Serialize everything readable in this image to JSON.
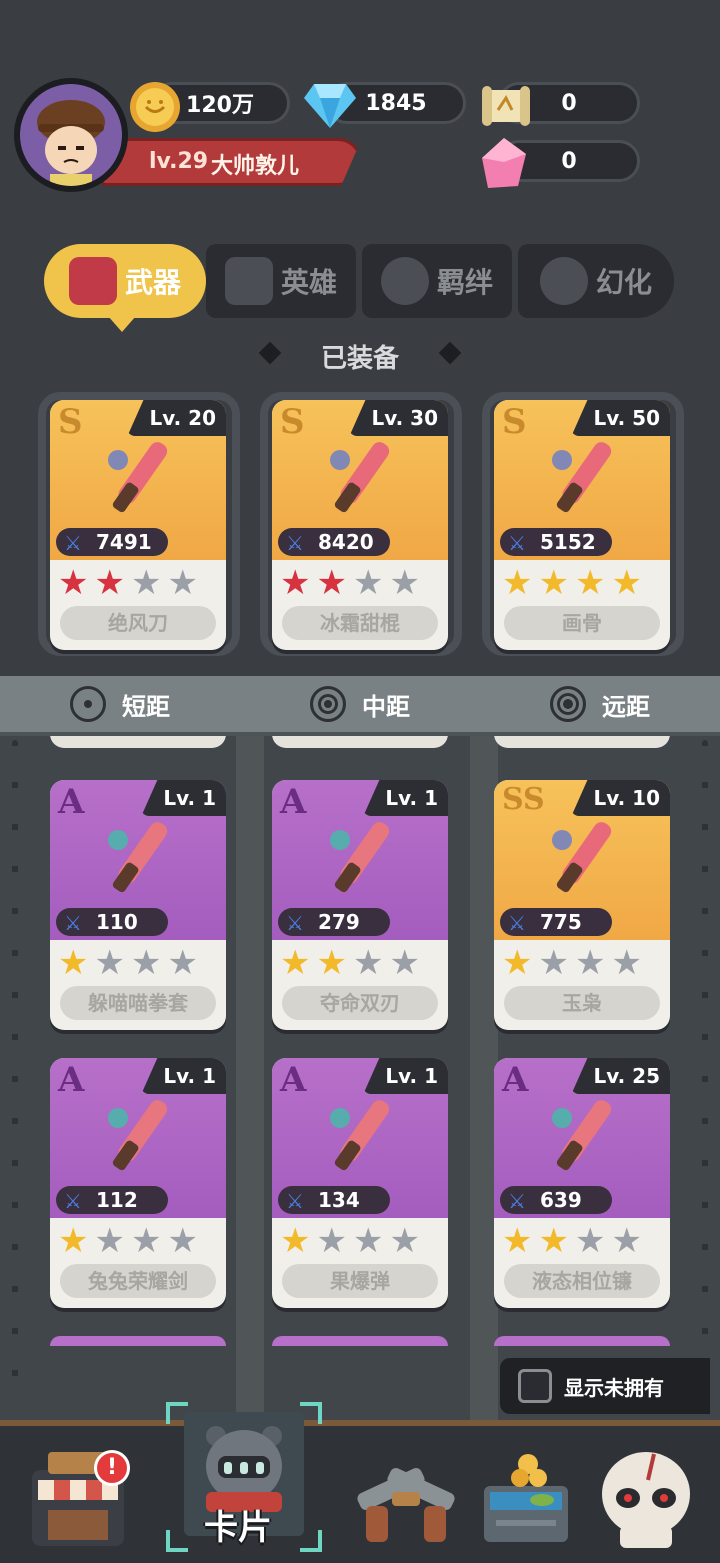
{
  "player": {
    "level": "lv.29",
    "name": "大帅敦儿"
  },
  "resources": {
    "gold": "120万",
    "diamond": "1845",
    "scroll": "0",
    "crystal": "0"
  },
  "tabs": [
    {
      "label": "武器",
      "active": true
    },
    {
      "label": "英雄",
      "active": false
    },
    {
      "label": "羁绊",
      "active": false
    },
    {
      "label": "幻化",
      "active": false
    }
  ],
  "equipped_title": "已装备",
  "equipped": [
    {
      "rarity": "S",
      "level": "Lv. 20",
      "power": "7491",
      "stars": [
        "red",
        "red",
        "gray",
        "gray"
      ],
      "name": "绝风刀"
    },
    {
      "rarity": "S",
      "level": "Lv. 30",
      "power": "8420",
      "stars": [
        "red",
        "red",
        "gray",
        "gray"
      ],
      "name": "冰霜甜棍"
    },
    {
      "rarity": "S",
      "level": "Lv. 50",
      "power": "5152",
      "stars": [
        "gold",
        "gold",
        "gold",
        "gold"
      ],
      "name": "画骨"
    }
  ],
  "ranges": [
    {
      "label": "短距",
      "icon": "short-range-icon"
    },
    {
      "label": "中距",
      "icon": "mid-range-icon"
    },
    {
      "label": "远距",
      "icon": "long-range-icon"
    }
  ],
  "weapons": [
    {
      "rarity": "A",
      "level": "Lv. 1",
      "power": "110",
      "stars": [
        "gold",
        "gray",
        "gray",
        "gray"
      ],
      "name": "躲喵喵拳套"
    },
    {
      "rarity": "A",
      "level": "Lv. 1",
      "power": "279",
      "stars": [
        "gold",
        "gold",
        "gray",
        "gray"
      ],
      "name": "夺命双刃"
    },
    {
      "rarity": "SS",
      "level": "Lv. 10",
      "power": "775",
      "stars": [
        "gold",
        "gray",
        "gray",
        "gray"
      ],
      "name": "玉枭"
    },
    {
      "rarity": "A",
      "level": "Lv. 1",
      "power": "112",
      "stars": [
        "gold",
        "gray",
        "gray",
        "gray"
      ],
      "name": "兔兔荣耀剑"
    },
    {
      "rarity": "A",
      "level": "Lv. 1",
      "power": "134",
      "stars": [
        "gold",
        "gray",
        "gray",
        "gray"
      ],
      "name": "果爆弹"
    },
    {
      "rarity": "A",
      "level": "Lv. 25",
      "power": "639",
      "stars": [
        "gold",
        "gold",
        "gray",
        "gray"
      ],
      "name": "液态相位镰"
    }
  ],
  "show_unowned_label": "显示未拥有",
  "bottom_nav": {
    "active_label": "卡片",
    "shop_badge": "!"
  },
  "colors": {
    "accent": "#f0c44a",
    "star_red": "#d6323f",
    "star_gold": "#f2b92b",
    "level_bar": "#b33a3a"
  }
}
